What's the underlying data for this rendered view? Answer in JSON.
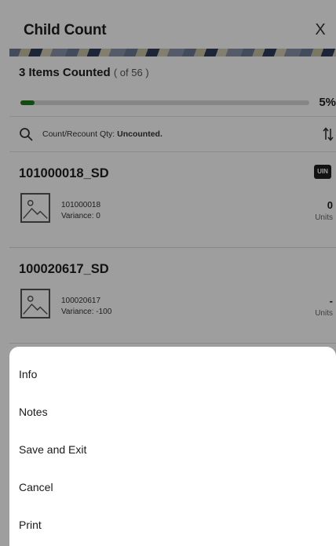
{
  "header": {
    "title": "Child Count",
    "close_label": "X"
  },
  "summary": {
    "counted_label": "3 Items Counted",
    "of_label": "( of 56 )",
    "progress_percent_label": "5%",
    "progress_fraction": 0.05
  },
  "search": {
    "prefix": "Count/Recount Qty: ",
    "value": "Uncounted."
  },
  "items": [
    {
      "title": "101000018_SD",
      "badge": "UIN",
      "sku": "101000018",
      "variance": "Variance: 0",
      "qty": "0",
      "unit": "Units"
    },
    {
      "title": "100020617_SD",
      "badge": "",
      "sku": "100020617",
      "variance": "Variance: -100",
      "qty": "-",
      "unit": "Units"
    }
  ],
  "sheet": {
    "items": [
      "Info",
      "Notes",
      "Save and Exit",
      "Cancel",
      "Print"
    ]
  },
  "colors": {
    "progress": "#1f7a1f",
    "scrim": "rgba(0,0,0,0.38)",
    "badge": "#1f1f1f"
  },
  "icons": {
    "search": "search-icon",
    "sort": "sort-icon",
    "thumb": "image-placeholder-icon",
    "close": "close-icon"
  }
}
